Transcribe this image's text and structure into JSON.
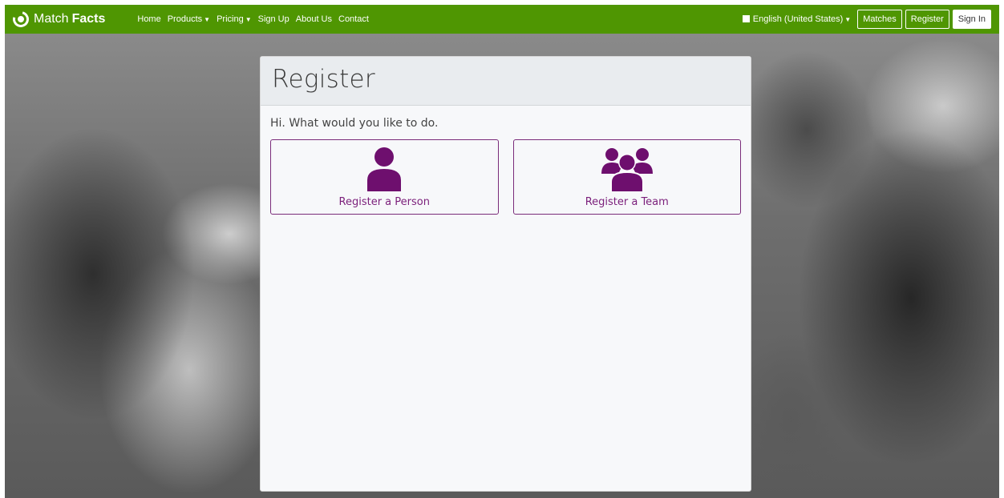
{
  "brand": {
    "name_light": "Match",
    "name_bold": "Facts"
  },
  "nav": {
    "links": [
      {
        "label": "Home",
        "dropdown": false
      },
      {
        "label": "Products",
        "dropdown": true
      },
      {
        "label": "Pricing",
        "dropdown": true
      },
      {
        "label": "Sign Up",
        "dropdown": false
      },
      {
        "label": "About Us",
        "dropdown": false
      },
      {
        "label": "Contact",
        "dropdown": false
      }
    ],
    "language": "English (United States)",
    "buttons": {
      "matches": "Matches",
      "register": "Register",
      "sign_in": "Sign In"
    }
  },
  "page": {
    "title": "Register",
    "intro": "Hi. What would you like to do.",
    "options": [
      {
        "label": "Register a Person",
        "icon": "person-icon"
      },
      {
        "label": "Register a Team",
        "icon": "team-icon"
      }
    ]
  },
  "colors": {
    "navbar": "#4f9602",
    "accent_purple": "#6e0f6e",
    "card_bg": "#f7f8fa",
    "card_header_bg": "#e9ecef"
  }
}
